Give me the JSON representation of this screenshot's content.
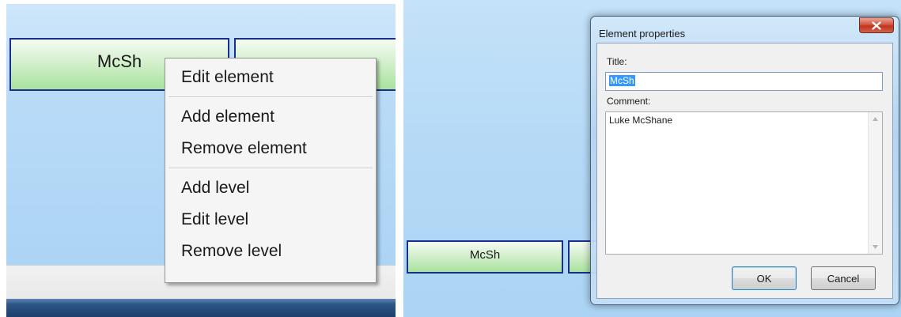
{
  "left": {
    "element_button_label": "McSh",
    "context_menu": {
      "items": [
        {
          "label": "Edit element"
        },
        {
          "label": "Add element"
        },
        {
          "label": "Remove element"
        },
        {
          "label": "Add level"
        },
        {
          "label": "Edit level"
        },
        {
          "label": "Remove level"
        }
      ]
    }
  },
  "right": {
    "element_button_label": "McSh",
    "dialog": {
      "title": "Element properties",
      "title_field_label": "Title:",
      "title_value": "McSh",
      "comment_field_label": "Comment:",
      "comment_value": "Luke McShane",
      "ok_label": "OK",
      "cancel_label": "Cancel"
    }
  },
  "colors": {
    "element_border": "#1a2e8c",
    "element_fill": "#a9e29e",
    "selection": "#3399ff",
    "close_button": "#c3331c"
  }
}
